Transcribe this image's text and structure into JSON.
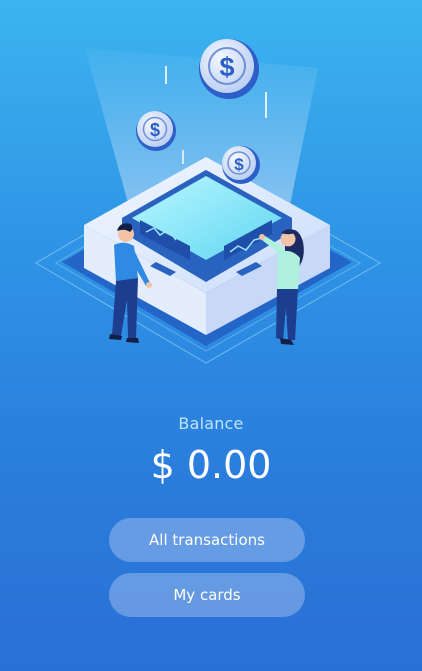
{
  "balance": {
    "label": "Balance",
    "amount": "$ 0.00"
  },
  "actions": {
    "all_transactions": "All transactions",
    "my_cards": "My cards"
  },
  "colors": {
    "background_top": "#3cb4ef",
    "background_bottom": "#2a6fd6",
    "button_fill": "#96b9eb",
    "text_primary": "#ffffff",
    "text_secondary": "#bfe3fb"
  },
  "illustration": {
    "subject": "isometric-platform-with-coins",
    "icons": [
      "dollar-coin-icon",
      "dollar-coin-icon",
      "dollar-coin-icon"
    ]
  }
}
